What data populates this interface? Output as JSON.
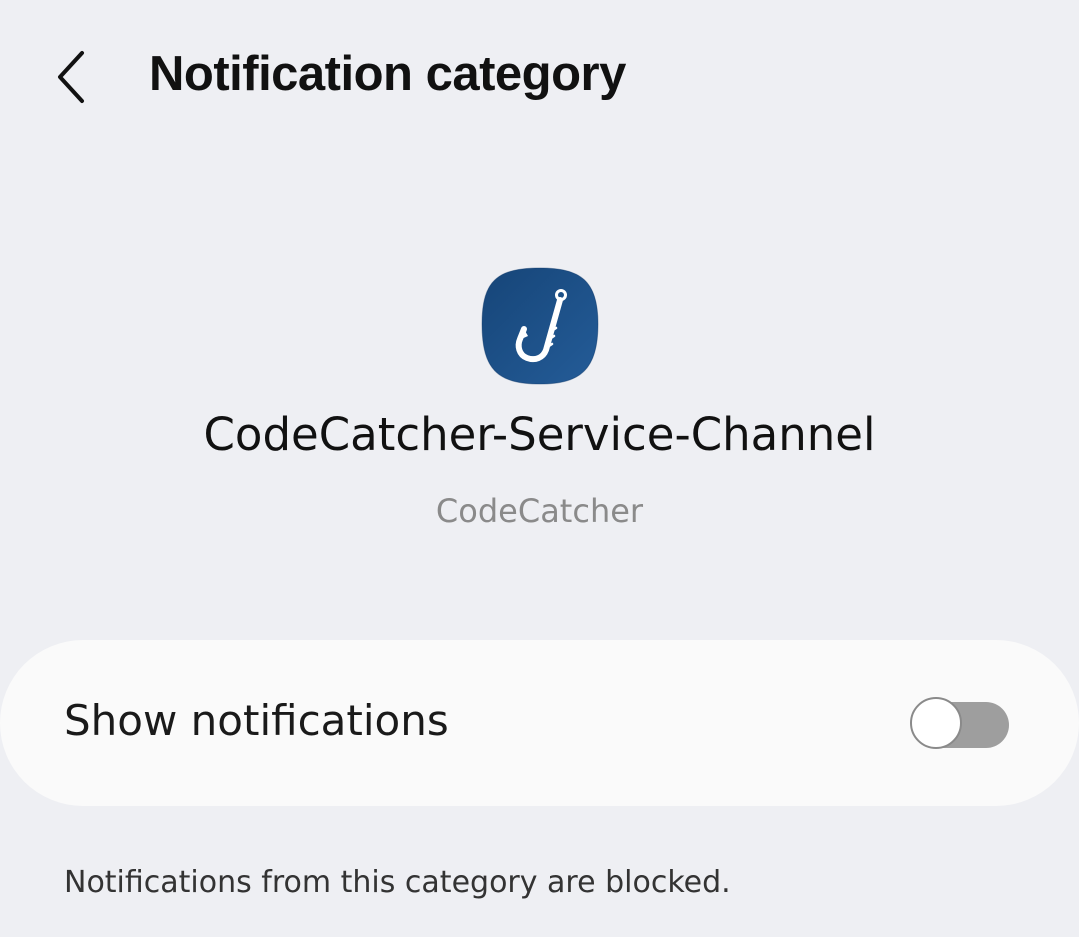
{
  "header": {
    "title": "Notification category",
    "back_icon": "chevron-left-icon"
  },
  "app": {
    "icon": "fish-hook-icon",
    "icon_color": "#1d4f8a",
    "channel_name": "CodeCatcher-Service-Channel",
    "app_name": "CodeCatcher"
  },
  "settings": {
    "show_notifications_label": "Show notifications",
    "show_notifications_enabled": false,
    "blocked_message": "Notifications from this category are blocked."
  },
  "colors": {
    "background": "#eeeff3",
    "card": "#fafafa",
    "switch_off_track": "#9e9e9e"
  }
}
